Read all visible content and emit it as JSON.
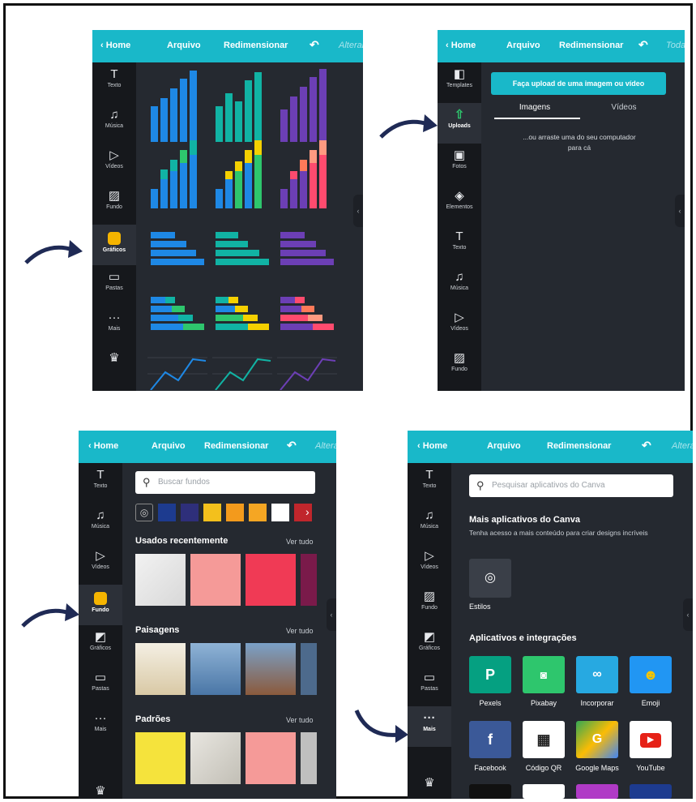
{
  "toolbar": {
    "home": "Home",
    "arquivo": "Arquivo",
    "redimensionar": "Redimensionar",
    "undo": "↶",
    "alterar": "Alterar",
    "todas": "Toda"
  },
  "panel1": {
    "sidebar": [
      {
        "label": "Texto"
      },
      {
        "label": "Música"
      },
      {
        "label": "Vídeos"
      },
      {
        "label": "Fundo"
      },
      {
        "label": "Gráficos"
      },
      {
        "label": "Pastas"
      },
      {
        "label": "Mais"
      }
    ]
  },
  "panel2": {
    "sidebar": [
      {
        "label": "Templates"
      },
      {
        "label": "Uploads"
      },
      {
        "label": "Fotos"
      },
      {
        "label": "Elementos"
      },
      {
        "label": "Texto"
      },
      {
        "label": "Música"
      },
      {
        "label": "Vídeos"
      },
      {
        "label": "Fundo"
      }
    ],
    "upload_button": "Faça upload de uma imagem ou vídeo",
    "tabs": [
      "Imagens",
      "Vídeos"
    ],
    "drop_text": "...ou arraste uma do seu computador para cá"
  },
  "panel3": {
    "sidebar": [
      {
        "label": "Texto"
      },
      {
        "label": "Música"
      },
      {
        "label": "Vídeos"
      },
      {
        "label": "Fundo"
      },
      {
        "label": "Gráficos"
      },
      {
        "label": "Pastas"
      },
      {
        "label": "Mais"
      }
    ],
    "search_placeholder": "Buscar fundos",
    "swatches": [
      "#1d3b8f",
      "#2e2f7a",
      "#f3c01c",
      "#f39a1c",
      "#f5a623",
      "#ffffff",
      "#c0262c"
    ],
    "sections": [
      {
        "title": "Usados recentemente",
        "link": "Ver tudo"
      },
      {
        "title": "Paisagens",
        "link": "Ver tudo"
      },
      {
        "title": "Padrões",
        "link": "Ver tudo"
      }
    ]
  },
  "panel4": {
    "sidebar": [
      {
        "label": "Texto"
      },
      {
        "label": "Música"
      },
      {
        "label": "Vídeos"
      },
      {
        "label": "Fundo"
      },
      {
        "label": "Gráficos"
      },
      {
        "label": "Pastas"
      },
      {
        "label": "Mais"
      }
    ],
    "search_placeholder": "Pesquisar aplicativos do Canva",
    "more_title": "Mais aplicativos do Canva",
    "more_desc": "Tenha acesso a mais conteúdo para criar designs incríveis",
    "styles_label": "Estilos",
    "apps_title": "Aplicativos e integrações",
    "apps": [
      {
        "label": "Pexels",
        "color": "#05a081"
      },
      {
        "label": "Pixabay",
        "color": "#2ec66d"
      },
      {
        "label": "Incorporar",
        "color": "#27a9e1"
      },
      {
        "label": "Emoji",
        "color": "#2196f3"
      },
      {
        "label": "Facebook",
        "color": "#3b5998"
      },
      {
        "label": "Código QR",
        "color": "#ffffff"
      },
      {
        "label": "Google Maps",
        "color": "#34a853"
      },
      {
        "label": "YouTube",
        "color": "#ffffff"
      }
    ]
  }
}
